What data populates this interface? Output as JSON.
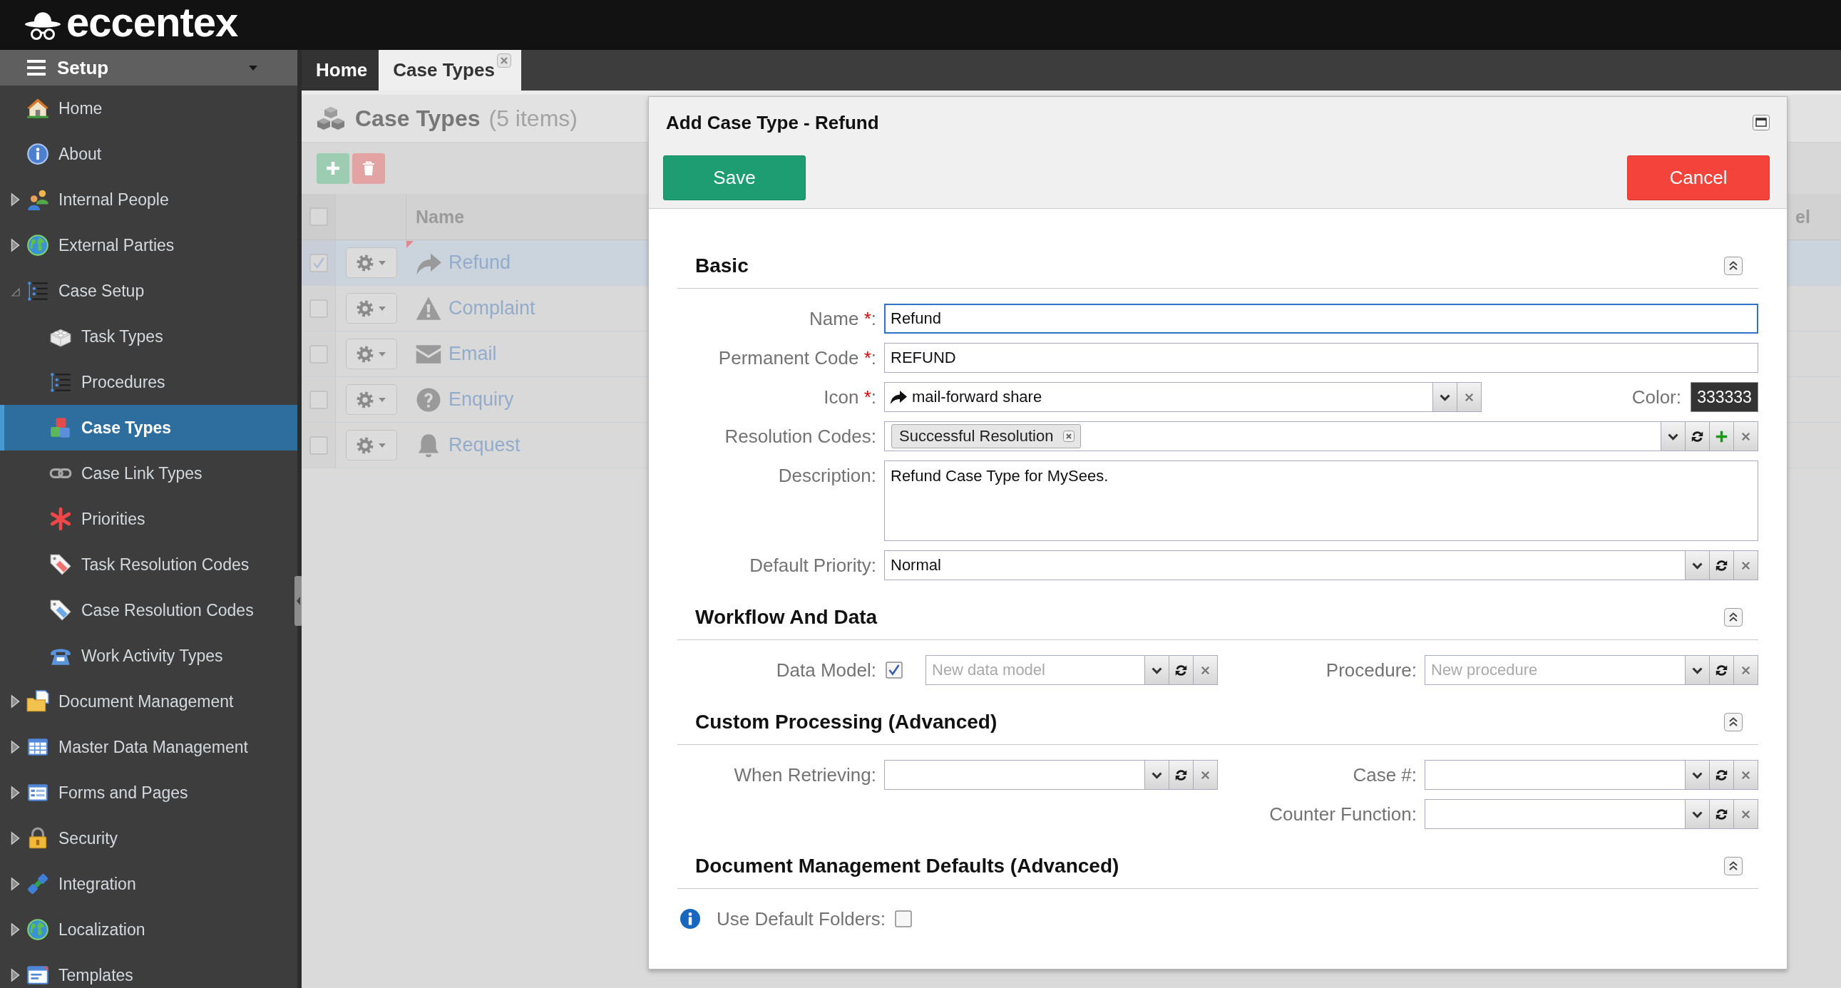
{
  "app_header": {
    "logo_text": "eccentex"
  },
  "sidebar": {
    "title": "Setup",
    "items": [
      {
        "label": "Home",
        "kind": "page",
        "selected": false
      },
      {
        "label": "About",
        "kind": "page",
        "selected": false
      },
      {
        "label": "Internal People",
        "kind": "group",
        "expanded": false,
        "selected": false
      },
      {
        "label": "External Parties",
        "kind": "group",
        "expanded": false,
        "selected": false
      },
      {
        "label": "Case Setup",
        "kind": "group",
        "expanded": true,
        "selected": false,
        "children": [
          {
            "label": "Task Types",
            "selected": false
          },
          {
            "label": "Procedures",
            "selected": false
          },
          {
            "label": "Case Types",
            "selected": true
          },
          {
            "label": "Case Link Types",
            "selected": false
          },
          {
            "label": "Priorities",
            "selected": false
          },
          {
            "label": "Task Resolution Codes",
            "selected": false
          },
          {
            "label": "Case Resolution Codes",
            "selected": false
          },
          {
            "label": "Work Activity Types",
            "selected": false
          }
        ]
      },
      {
        "label": "Document Management",
        "kind": "group",
        "expanded": false,
        "selected": false
      },
      {
        "label": "Master Data Management",
        "kind": "group",
        "expanded": false,
        "selected": false
      },
      {
        "label": "Forms and Pages",
        "kind": "group",
        "expanded": false,
        "selected": false
      },
      {
        "label": "Security",
        "kind": "group",
        "expanded": false,
        "selected": false
      },
      {
        "label": "Integration",
        "kind": "group",
        "expanded": false,
        "selected": false
      },
      {
        "label": "Localization",
        "kind": "group",
        "expanded": false,
        "selected": false
      },
      {
        "label": "Templates",
        "kind": "group",
        "expanded": false,
        "selected": false
      }
    ]
  },
  "tabs": [
    {
      "label": "Home",
      "selected": false,
      "closable": false
    },
    {
      "label": "Case Types",
      "selected": true,
      "closable": true
    }
  ],
  "list": {
    "title": "Case Types",
    "count": "(5 items)",
    "header_checked": false,
    "columns": [
      "Name",
      "el"
    ],
    "rows": [
      {
        "name": "Refund",
        "checked": true,
        "selected": true,
        "modified": true
      },
      {
        "name": "Complaint",
        "checked": false,
        "selected": false,
        "modified": false
      },
      {
        "name": "Email",
        "checked": false,
        "selected": false,
        "modified": false
      },
      {
        "name": "Enquiry",
        "checked": false,
        "selected": false,
        "modified": false
      },
      {
        "name": "Request",
        "checked": false,
        "selected": false,
        "modified": false
      }
    ]
  },
  "dialog": {
    "title": "Add Case Type - Refund",
    "buttons": [
      {
        "label": "Save",
        "kind": "primary"
      },
      {
        "label": "Cancel",
        "kind": "danger"
      }
    ],
    "sections": [
      {
        "title": "Basic",
        "expanded": true,
        "fields": [
          {
            "kind": "text",
            "label": "Name",
            "required_mark": "*",
            "label_end": ":",
            "value": "Refund",
            "focused": true
          },
          {
            "kind": "text",
            "label": "Permanent Code",
            "required_mark": "*",
            "label_end": ":",
            "value": "REFUND",
            "focused": false
          },
          {
            "kind": "icon-select",
            "label": "Icon",
            "required_mark": "*",
            "label_end": ":",
            "value": "mail-forward share",
            "color_field": {
              "label": "Color:",
              "value": "333333"
            }
          },
          {
            "kind": "tags",
            "label": "Resolution Codes:",
            "tags": [
              "Successful Resolution"
            ]
          },
          {
            "kind": "textarea",
            "label": "Description:",
            "value": "Refund Case Type for MySees."
          },
          {
            "kind": "select",
            "label": "Default Priority:",
            "value": "Normal"
          }
        ]
      },
      {
        "title": "Workflow And Data",
        "expanded": true,
        "columns": [
          [
            {
              "kind": "checkbox-select",
              "label": "Data Model:",
              "checked": true,
              "placeholder": "New data model"
            }
          ],
          [
            {
              "kind": "select",
              "label": "Procedure:",
              "placeholder": "New procedure"
            }
          ]
        ]
      },
      {
        "title": "Custom Processing (Advanced)",
        "expanded": true,
        "columns": [
          [
            {
              "kind": "select",
              "label": "When Retrieving:"
            }
          ],
          [
            {
              "kind": "select",
              "label": "Case #:"
            },
            {
              "kind": "select",
              "label": "Counter Function:"
            }
          ]
        ]
      },
      {
        "title": "Document Management Defaults (Advanced)",
        "expanded": true,
        "fields": [
          {
            "kind": "checkbox",
            "label": "Use Default Folders:",
            "checked": false,
            "help": true
          }
        ]
      }
    ]
  }
}
